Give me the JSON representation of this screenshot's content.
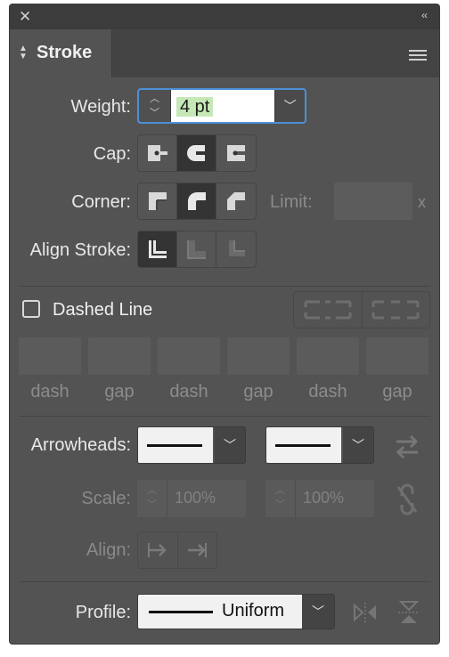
{
  "panel": {
    "close_glyph": "✕",
    "collapse_glyph": "‹‹",
    "tab_title": "Stroke",
    "menu_icon": "hamburger-menu-icon"
  },
  "weight": {
    "label": "Weight:",
    "value": "4 pt"
  },
  "cap": {
    "label": "Cap:",
    "options": [
      "butt-cap-icon",
      "round-cap-icon",
      "projecting-cap-icon"
    ],
    "selected": 1
  },
  "corner": {
    "label": "Corner:",
    "options": [
      "miter-join-icon",
      "round-join-icon",
      "bevel-join-icon"
    ],
    "selected": 1,
    "limit_label": "Limit:",
    "limit_suffix": "x"
  },
  "align_stroke": {
    "label": "Align Stroke:",
    "options": [
      "align-center-icon",
      "align-inside-icon",
      "align-outside-icon"
    ],
    "selected": 0
  },
  "dashed": {
    "label": "Dashed Line",
    "checked": false,
    "fields": [
      {
        "label": "dash"
      },
      {
        "label": "gap"
      },
      {
        "label": "dash"
      },
      {
        "label": "gap"
      },
      {
        "label": "dash"
      },
      {
        "label": "gap"
      }
    ]
  },
  "arrowheads": {
    "label": "Arrowheads:"
  },
  "scale": {
    "label": "Scale:",
    "start": "100%",
    "end": "100%"
  },
  "align": {
    "label": "Align:"
  },
  "profile": {
    "label": "Profile:",
    "value": "Uniform"
  },
  "colors": {
    "panel_bg": "#535353",
    "focus_ring": "#4c8fd6",
    "weight_highlight": "#c6e8b6",
    "selected_button": "#343434"
  }
}
